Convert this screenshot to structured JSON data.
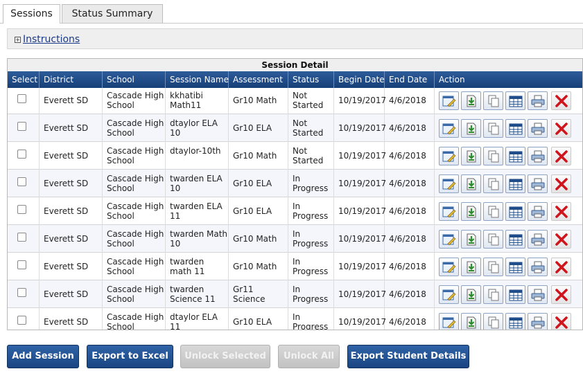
{
  "tabs": [
    {
      "label": "Sessions",
      "active": true
    },
    {
      "label": "Status Summary",
      "active": false
    }
  ],
  "instructions": {
    "label": "Instructions",
    "expand_glyph": "+"
  },
  "table": {
    "caption": "Session Detail",
    "columns": [
      "Select",
      "District",
      "School",
      "Session Name",
      "Assessment",
      "Status",
      "Begin Date",
      "End Date",
      "Action"
    ],
    "rows": [
      {
        "district": "Everett SD",
        "school": "Cascade High School",
        "session": "kkhatibi Math11",
        "assessment": "Gr10 Math",
        "status": "Not Started",
        "begin": "10/19/2017",
        "end": "4/6/2018"
      },
      {
        "district": "Everett SD",
        "school": "Cascade High School",
        "session": "dtaylor ELA 10",
        "assessment": "Gr10 ELA",
        "status": "Not Started",
        "begin": "10/19/2017",
        "end": "4/6/2018"
      },
      {
        "district": "Everett SD",
        "school": "Cascade High School",
        "session": "dtaylor-10th",
        "assessment": "Gr10 Math",
        "status": "Not Started",
        "begin": "10/19/2017",
        "end": "4/6/2018"
      },
      {
        "district": "Everett SD",
        "school": "Cascade High School",
        "session": "twarden ELA 10",
        "assessment": "Gr10 ELA",
        "status": "In Progress",
        "begin": "10/19/2017",
        "end": "4/6/2018"
      },
      {
        "district": "Everett SD",
        "school": "Cascade High School",
        "session": "twarden ELA 11",
        "assessment": "Gr10 ELA",
        "status": "In Progress",
        "begin": "10/19/2017",
        "end": "4/6/2018"
      },
      {
        "district": "Everett SD",
        "school": "Cascade High School",
        "session": "twarden Math 10",
        "assessment": "Gr10 Math",
        "status": "In Progress",
        "begin": "10/19/2017",
        "end": "4/6/2018"
      },
      {
        "district": "Everett SD",
        "school": "Cascade High School",
        "session": "twarden math 11",
        "assessment": "Gr10 Math",
        "status": "In Progress",
        "begin": "10/19/2017",
        "end": "4/6/2018"
      },
      {
        "district": "Everett SD",
        "school": "Cascade High School",
        "session": "twarden Science 11",
        "assessment": "Gr11 Science",
        "status": "In Progress",
        "begin": "10/19/2017",
        "end": "4/6/2018"
      },
      {
        "district": "Everett SD",
        "school": "Cascade High School",
        "session": "dtaylor ELA 11",
        "assessment": "Gr10 ELA",
        "status": "In Progress",
        "begin": "10/19/2017",
        "end": "4/6/2018"
      }
    ],
    "action_icons": [
      "edit-session-icon",
      "download-icon",
      "copy-icon",
      "roster-table-icon",
      "print-icon",
      "delete-icon"
    ]
  },
  "buttons": [
    {
      "label": "Add Session",
      "enabled": true
    },
    {
      "label": "Export to Excel",
      "enabled": true
    },
    {
      "label": "Unlock Selected",
      "enabled": false
    },
    {
      "label": "Unlock All",
      "enabled": false
    },
    {
      "label": "Export Student Details",
      "enabled": true
    }
  ],
  "colors": {
    "header_blue": "#1f4c8a",
    "delete_red": "#d0141c"
  }
}
